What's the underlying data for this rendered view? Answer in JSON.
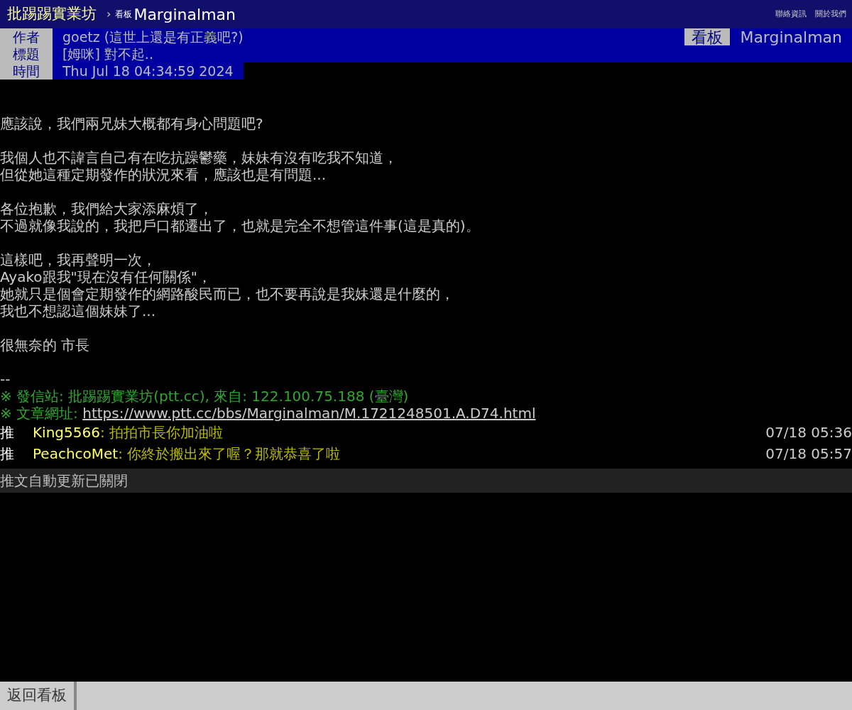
{
  "topbar": {
    "site": "批踢踢實業坊",
    "separator": "›",
    "board_label": "看板",
    "board": "Marginalman",
    "links": [
      "聯絡資訊",
      "關於我們"
    ]
  },
  "meta": [
    {
      "label": "作者",
      "value": "goetz (這世上還是有正義吧?)"
    },
    {
      "label": "標題",
      "value": "[姆咪] 對不起.."
    },
    {
      "label": "時間",
      "value": "Thu Jul 18 04:34:59 2024"
    }
  ],
  "board_tag": {
    "label": "看板",
    "value": "Marginalman"
  },
  "content": [
    [
      "應該說，我們兩兄妹大概都有身心問題吧?"
    ],
    [
      "我個人也不諱言自己有在吃抗躁鬱藥，妹妹有沒有吃我不知道，",
      "但從她這種定期發作的狀況來看，應該也是有問題..."
    ],
    [
      "各位抱歉，我們給大家添麻煩了，",
      "不過就像我說的，我把戶口都遷出了，也就是完全不想管這件事(這是真的)。"
    ],
    [
      "這樣吧，我再聲明一次，",
      "Ayako跟我\"現在沒有任何關係\"，",
      "她就只是個會定期發作的網路酸民而已，也不要再說是我妹還是什麼的，",
      "我也不想認這個妹妹了..."
    ],
    [
      "很無奈的 市長"
    ],
    [
      "--"
    ]
  ],
  "signature": [
    {
      "kind": "text",
      "text": "※ 發信站: 批踢踢實業坊(ptt.cc), 來自: 122.100.75.188 (臺灣)"
    },
    {
      "kind": "link",
      "label": "※ 文章網址: ",
      "url": "https://www.ptt.cc/bbs/Marginalman/M.1721248501.A.D74.html"
    }
  ],
  "pushes": [
    {
      "tag": "推",
      "user": "King5566",
      "content": ": 拍拍市長你加油啦",
      "time": "07/18 05:36"
    },
    {
      "tag": "推",
      "user": "PeachcoMet",
      "content": ": 你終於搬出來了喔？那就恭喜了啦",
      "time": "07/18 05:57"
    }
  ],
  "status": "推文自動更新已關閉",
  "bottom_button": "返回看板"
}
